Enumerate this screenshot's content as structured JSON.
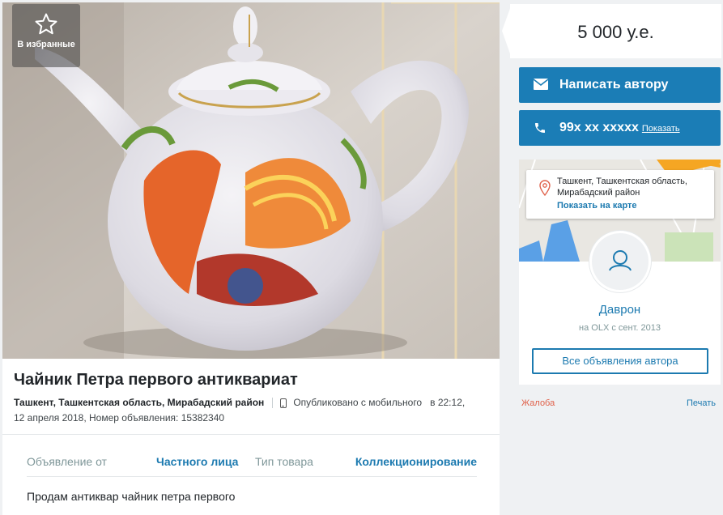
{
  "favorite": {
    "label": "В избранные",
    "icon": "star-icon"
  },
  "listing": {
    "title": "Чайник Петра первого антиквариат",
    "location": "Ташкент, Ташкентская область, Мирабадский район",
    "published": "Опубликовано с мобильного",
    "published_time": "в 22:12,",
    "published_date_id": "12 апреля 2018, Номер объявления: 15382340",
    "details": {
      "key1": "Объявление от",
      "value1": "Частного лица",
      "key2": "Тип товара",
      "value2": "Коллекционирование"
    },
    "description": "Продам антиквар чайник петра первого"
  },
  "sidebar": {
    "price": "5 000 у.е.",
    "write_button": "Написать автору",
    "phone_number": "99x xx xxxxx",
    "phone_show": "Показать",
    "address": "Ташкент, Ташкентская область, Мирабадский район",
    "show_on_map": "Показать на карте",
    "user_name": "Даврон",
    "user_since": "на OLX с сент. 2013",
    "all_ads_button": "Все объявления автора",
    "complain": "Жалоба",
    "print": "Печать"
  },
  "colors": {
    "accent": "#1b7db6",
    "link": "#1c7ab0",
    "complain": "#e0614a",
    "background": "#eff1f3"
  }
}
